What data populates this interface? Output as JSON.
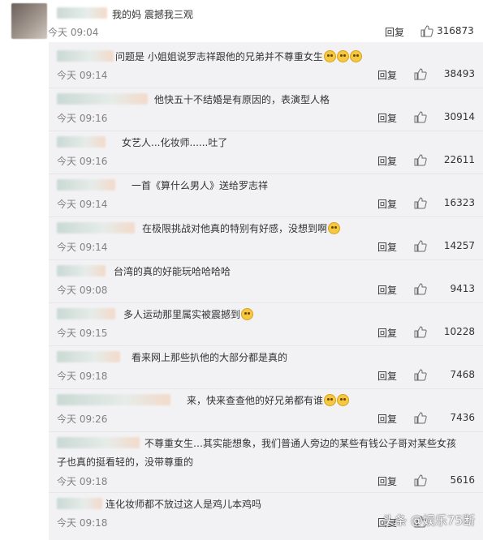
{
  "top_comment": {
    "text": "我的妈 震撼我三观",
    "time": "今天 09:04",
    "reply_label": "回复",
    "likes": "316873"
  },
  "replies": [
    {
      "text": "问题是 小姐姐说罗志祥跟他的兄弟并不尊重女生",
      "emojis": 3,
      "time": "今天 09:14",
      "reply_label": "回复",
      "likes": "38493"
    },
    {
      "text": "他快五十不结婚是有原因的，表演型人格",
      "emojis": 0,
      "time": "今天 09:16",
      "reply_label": "回复",
      "likes": "30914"
    },
    {
      "text": "女艺人...化妆师......吐了",
      "emojis": 0,
      "time": "今天 09:16",
      "reply_label": "回复",
      "likes": "22611"
    },
    {
      "text": "一首《算什么男人》送给罗志祥",
      "emojis": 0,
      "time": "今天 09:14",
      "reply_label": "回复",
      "likes": "16323"
    },
    {
      "text": "在极限挑战对他真的特别有好感，没想到啊",
      "emojis": 1,
      "time": "今天 09:14",
      "reply_label": "回复",
      "likes": "14257"
    },
    {
      "text": "台湾的真的好能玩哈哈哈哈",
      "emojis": 0,
      "time": "今天 09:08",
      "reply_label": "回复",
      "likes": "9413"
    },
    {
      "text": "多人运动那里属实被震撼到",
      "emojis": 1,
      "time": "今天 09:15",
      "reply_label": "回复",
      "likes": "10228"
    },
    {
      "text": "看来网上那些扒他的大部分都是真的",
      "emojis": 0,
      "time": "今天 09:18",
      "reply_label": "回复",
      "likes": "7468"
    },
    {
      "text": "来，快来查查他的好兄弟都有谁",
      "emojis": 2,
      "time": "今天 09:26",
      "reply_label": "回复",
      "likes": "7436"
    },
    {
      "text": "不尊重女生…其实能想象，我们普通人旁边的某些有钱公子哥对某些女孩",
      "text2": "子也真的挺看轻的，没带尊重的",
      "emojis": 0,
      "time": "今天 09:18",
      "reply_label": "回复",
      "likes": "5616"
    },
    {
      "text": "连化妆师都不放过这人是鸡儿本鸡吗",
      "emojis": 0,
      "time": "今天 09:18",
      "reply_label": "回复",
      "likes": ""
    }
  ],
  "watermark": "头条 @娱乐75断",
  "icons": {
    "like": "thumbs-up-icon",
    "avatar": "avatar"
  }
}
